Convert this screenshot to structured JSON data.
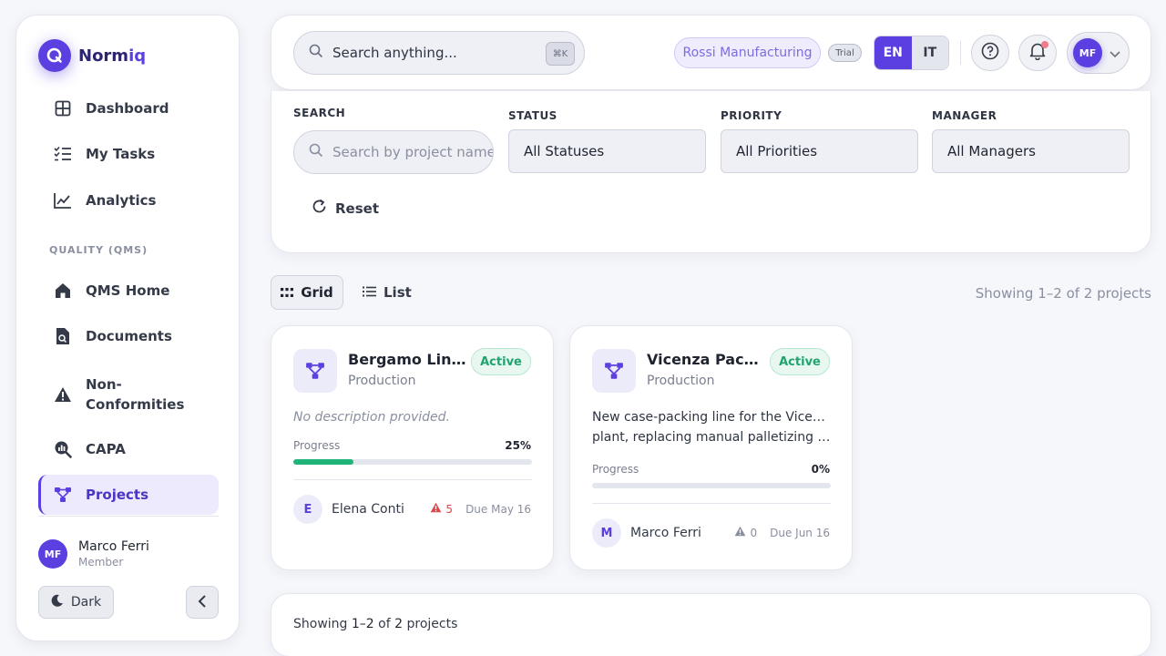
{
  "brand": {
    "name_part1": "Norm",
    "name_part2": "iq",
    "logo_letter": "Q",
    "accent": "#5b3fe0"
  },
  "sidebar": {
    "items_top": [
      {
        "label": "Dashboard",
        "icon": "grid-icon"
      },
      {
        "label": "My Tasks",
        "icon": "checklist-icon"
      },
      {
        "label": "Analytics",
        "icon": "line-chart-icon"
      }
    ],
    "section_label": "QUALITY (QMS)",
    "items_qms": [
      {
        "label": "QMS Home",
        "icon": "home-icon"
      },
      {
        "label": "Documents",
        "icon": "document-icon"
      },
      {
        "label_line1": "Non-",
        "label_line2": "Conformities",
        "icon": "warning-icon"
      },
      {
        "label": "CAPA",
        "icon": "search-chart-icon"
      },
      {
        "label": "Projects",
        "icon": "project-icon",
        "active": true
      }
    ],
    "user": {
      "initials": "MF",
      "name": "Marco Ferri",
      "role": "Member"
    },
    "dark_label": "Dark"
  },
  "topbar": {
    "search_placeholder": "Search anything...",
    "shortcut": "⌘K",
    "org": "Rossi Manufacturing",
    "plan": "Trial",
    "lang_active": "EN",
    "lang_other": "IT",
    "profile_initials": "MF"
  },
  "filters": {
    "search_label": "SEARCH",
    "search_placeholder": "Search by project name",
    "status_label": "STATUS",
    "status_value": "All Statuses",
    "priority_label": "PRIORITY",
    "priority_value": "All Priorities",
    "manager_label": "MANAGER",
    "manager_value": "All Managers",
    "reset_label": "Reset"
  },
  "view": {
    "grid_label": "Grid",
    "list_label": "List",
    "showing": "Showing 1–2 of 2 projects"
  },
  "projects": [
    {
      "title": "Bergamo Line ...",
      "category": "Production",
      "status": "Active",
      "description": "No description provided.",
      "progress_label": "Progress",
      "progress_text": "25%",
      "progress": 0.25,
      "manager_initial": "E",
      "manager": "Elena Conti",
      "issues": "5",
      "due": "Due May 16"
    },
    {
      "title": "Vicenza Packa...",
      "category": "Production",
      "status": "Active",
      "description_line1": "New case-packing line for the Vicenza",
      "description_line2": "plant, replacing manual palletizing wit...",
      "progress_label": "Progress",
      "progress_text": "0%",
      "progress": 0,
      "manager_initial": "M",
      "manager": "Marco Ferri",
      "issues": "0",
      "due": "Due Jun 16"
    }
  ],
  "footer": {
    "prefix": "Showing ",
    "range": "1–2",
    "of": " of ",
    "total": "2",
    "suffix": " projects"
  }
}
